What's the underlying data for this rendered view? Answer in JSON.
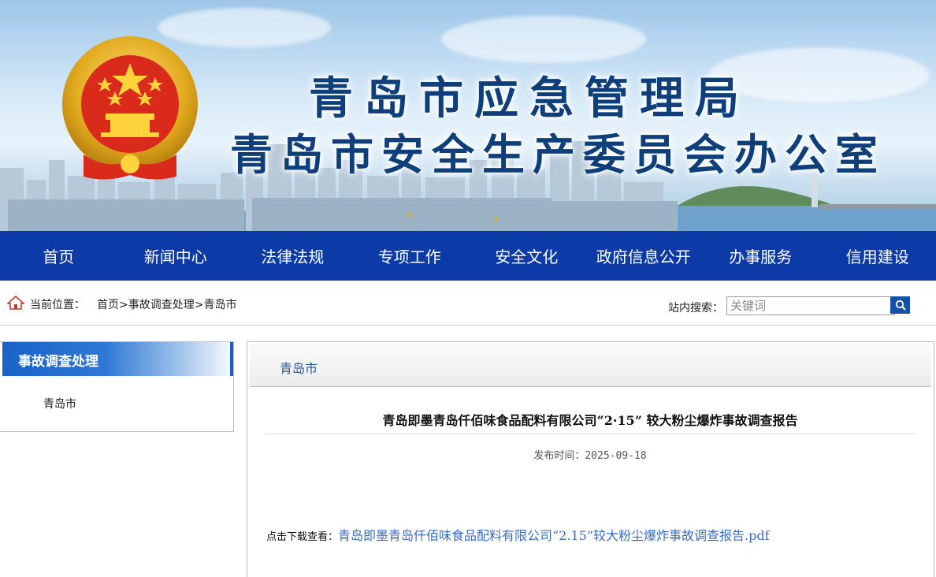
{
  "banner": {
    "title_line1": "青岛市应急管理局",
    "title_line2": "青岛市安全生产委员会办公室",
    "emblem_icon": "national-emblem-icon"
  },
  "nav": {
    "items": [
      "首页",
      "新闻中心",
      "法律法规",
      "专项工作",
      "安全文化",
      "政府信息公开",
      "办事服务",
      "信用建设"
    ],
    "background": "#0c3aa6"
  },
  "breadcrumb": {
    "icon": "home-icon",
    "label": "当前位置：",
    "items": [
      "首页",
      "事故调查处理",
      "青岛市"
    ],
    "separator": ">"
  },
  "search": {
    "label": "站内搜索：",
    "placeholder": "关键词",
    "button_icon": "search-icon"
  },
  "sidebar": {
    "heading": "事故调查处理",
    "items": [
      "青岛市"
    ]
  },
  "panel": {
    "heading": "青岛市",
    "article": {
      "title": "青岛即墨青岛仟佰味食品配料有限公司“2·15” 较大粉尘爆炸事故调查报告",
      "date_label": "发布时间：",
      "date": "2025-09-18",
      "download_label": "点击下载查看：",
      "download_link": "青岛即墨青岛仟佰味食品配料有限公司“2.15”较大粉尘爆炸事故调查报告.pdf"
    }
  },
  "colors": {
    "nav_bg": "#0c3aa6",
    "title_blue": "#0f3f7a",
    "link_blue": "#3a6dbf",
    "sidebar_head": "#1a63c8"
  }
}
